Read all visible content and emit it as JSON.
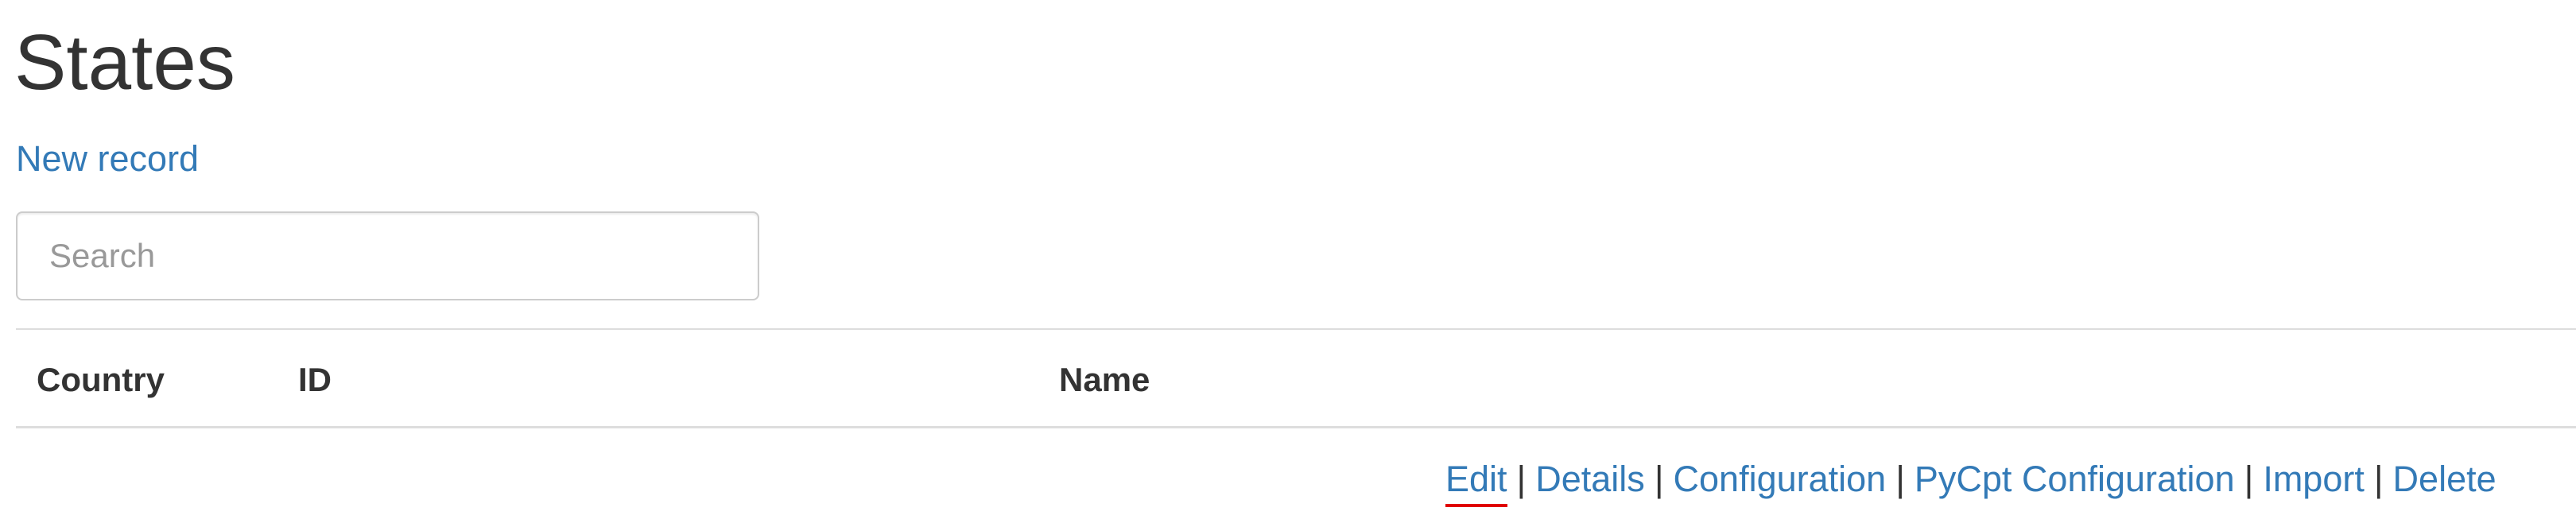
{
  "page": {
    "title": "States",
    "new_record_label": "New record"
  },
  "search": {
    "placeholder": "Search",
    "value": ""
  },
  "table": {
    "columns": [
      "Country",
      "ID",
      "Name"
    ]
  },
  "row_actions": {
    "edit": "Edit",
    "details": "Details",
    "configuration": "Configuration",
    "pycpt_configuration": "PyCpt Configuration",
    "import": "Import",
    "delete": "Delete",
    "separator": "|"
  },
  "colors": {
    "link": "#337ab7",
    "text": "#333333",
    "border": "#dddddd",
    "focus_underline": "#e00000"
  }
}
